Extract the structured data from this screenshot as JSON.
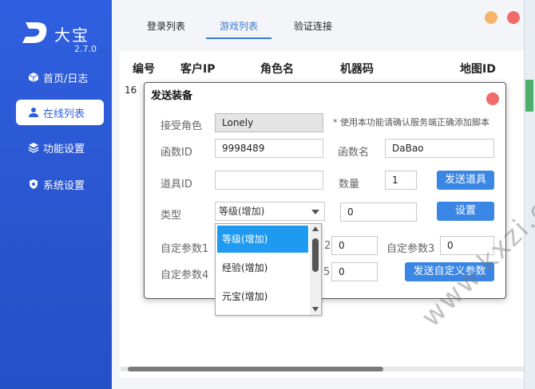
{
  "sidebar": {
    "app_name": "大宝",
    "version": "2.7.0",
    "items": [
      {
        "label": "首页/日志",
        "icon": "cube-icon"
      },
      {
        "label": "在线列表",
        "icon": "user-icon",
        "active": true
      },
      {
        "label": "功能设置",
        "icon": "layers-icon"
      },
      {
        "label": "系统设置",
        "icon": "shield-gear-icon"
      }
    ],
    "bg_color": "#2f5fe0"
  },
  "tabs": [
    {
      "label": "登录列表"
    },
    {
      "label": "游戏列表",
      "active": true
    },
    {
      "label": "验证连接"
    }
  ],
  "window_buttons": {
    "minimize_color": "#f5b46a",
    "close_color": "#f26b6b"
  },
  "table": {
    "columns": [
      "编号",
      "客户IP",
      "角色名",
      "机器码",
      "地图ID"
    ],
    "row_fragment": "16"
  },
  "dialog": {
    "title": "发送装备",
    "role_label": "接受角色",
    "role_value": "Lonely",
    "hint": "* 使用本功能请确认服务端正确添加脚本",
    "func_id_label": "函数ID",
    "func_id_value": "9998489",
    "func_name_label": "函数名",
    "func_name_value": "DaBao",
    "item_id_label": "道具ID",
    "item_id_value": "",
    "qty_label": "数量",
    "qty_value": "1",
    "send_item_button": "发送道具",
    "type_label": "类型",
    "type_selected": "等级(增加)",
    "type_value": "0",
    "set_button": "设置",
    "param1_label": "自定参数1",
    "param2_value": "0",
    "param3_label": "自定参数3",
    "param3_value": "0",
    "param4_label": "自定参数4",
    "param5_value": "0",
    "send_custom_button": "发送自定义参数",
    "partial_label_2": "2",
    "partial_label_5": "5",
    "dropdown_options": [
      "等级(增加)",
      "经验(增加)",
      "元宝(增加)"
    ]
  },
  "watermark": "www.kxzi.cn"
}
